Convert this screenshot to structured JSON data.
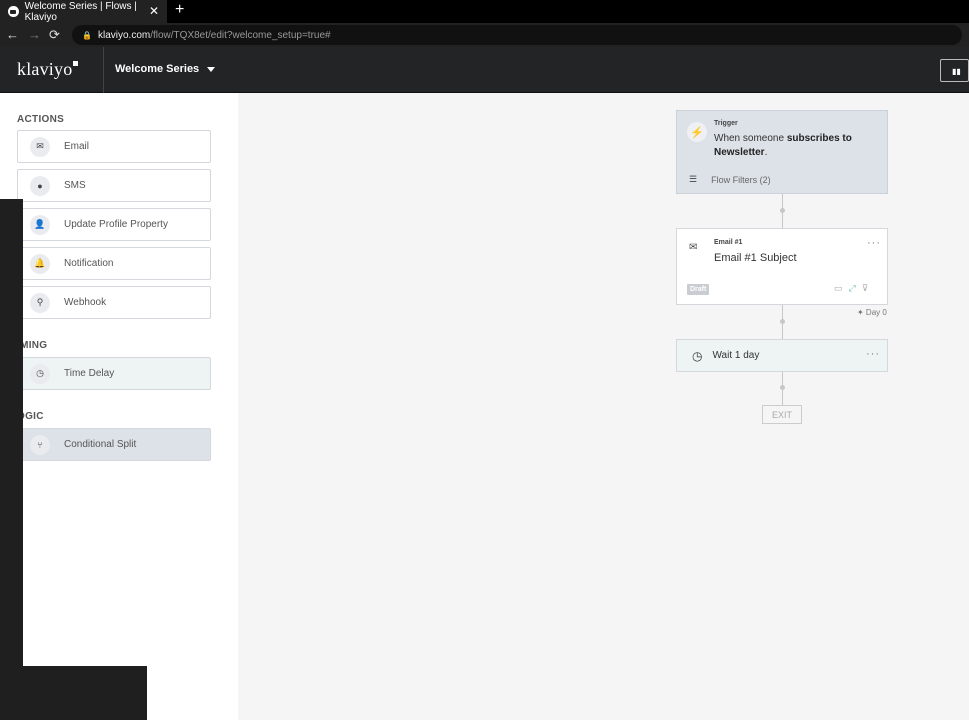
{
  "browser": {
    "tab_title": "Welcome Series | Flows | Klaviyo",
    "tab_close": "✕",
    "new_tab": "+",
    "url_domain": "klaviyo.com",
    "url_path": "/flow/TQX8et/edit?welcome_setup=true#"
  },
  "app": {
    "logo": "klaviyo",
    "flow_name": "Welcome Series"
  },
  "sidebar": {
    "actions_header": "ACTIONS",
    "actions": [
      {
        "label": "Email",
        "icon": "✉"
      },
      {
        "label": "SMS",
        "icon": "●"
      },
      {
        "label": "Update Profile Property",
        "icon": "👤"
      },
      {
        "label": "Notification",
        "icon": "🔔"
      },
      {
        "label": "Webhook",
        "icon": "⚲"
      }
    ],
    "timing_header": "IMING",
    "timing_item": {
      "label": "Time Delay",
      "icon": "◷"
    },
    "logic_header": "OGIC",
    "logic_item": {
      "label": "Conditional Split",
      "icon": "⑂"
    }
  },
  "flow": {
    "trigger": {
      "label": "Trigger",
      "text_prefix": "When someone ",
      "text_bold1": "subscribes to",
      "text_bold2": "Newsletter",
      "text_suffix": ".",
      "filters": "Flow Filters (2)"
    },
    "email": {
      "label": "Email #1",
      "subject": "Email #1 Subject",
      "status": "Draft",
      "more": "···"
    },
    "day_marker": "✦ Day 0",
    "wait": {
      "label": "Wait 1 day",
      "more": "···"
    },
    "exit": "EXIT"
  }
}
